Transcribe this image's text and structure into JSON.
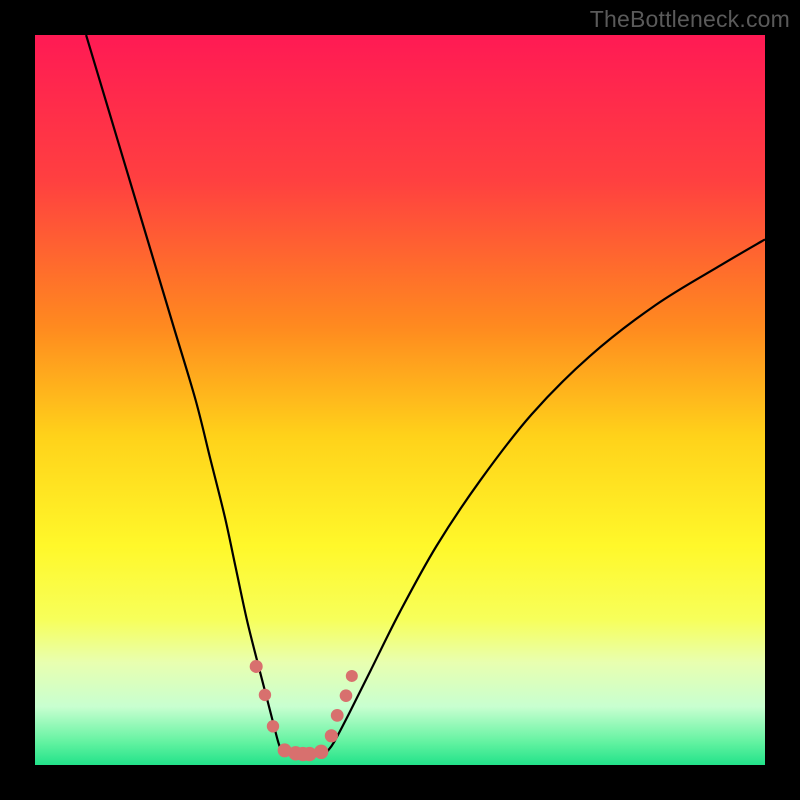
{
  "watermark": "TheBottleneck.com",
  "chart_data": {
    "type": "line",
    "title": "",
    "xlabel": "",
    "ylabel": "",
    "xlim": [
      0,
      100
    ],
    "ylim": [
      0,
      100
    ],
    "gradient_stops": [
      {
        "offset": 0.0,
        "color": "#ff1a54"
      },
      {
        "offset": 0.2,
        "color": "#ff4040"
      },
      {
        "offset": 0.4,
        "color": "#ff8a1f"
      },
      {
        "offset": 0.55,
        "color": "#ffd21a"
      },
      {
        "offset": 0.7,
        "color": "#fff82a"
      },
      {
        "offset": 0.8,
        "color": "#f7ff5a"
      },
      {
        "offset": 0.86,
        "color": "#e8ffb0"
      },
      {
        "offset": 0.92,
        "color": "#c8ffd0"
      },
      {
        "offset": 0.97,
        "color": "#60f2a0"
      },
      {
        "offset": 1.0,
        "color": "#22e28a"
      }
    ],
    "series": [
      {
        "name": "left-branch",
        "x": [
          7,
          10,
          13,
          16,
          19,
          22,
          24,
          26,
          27.5,
          29,
          30.5,
          31.8,
          32.7,
          33.3,
          33.8
        ],
        "y": [
          100,
          90,
          80,
          70,
          60,
          50,
          42,
          34,
          27,
          20,
          14,
          9,
          5.5,
          3.2,
          1.8
        ]
      },
      {
        "name": "right-branch",
        "x": [
          40,
          41,
          43,
          46,
          50,
          55,
          61,
          68,
          76,
          85,
          94,
          100
        ],
        "y": [
          1.8,
          3.2,
          7,
          13,
          21,
          30,
          39,
          48,
          56,
          63,
          68.5,
          72
        ]
      },
      {
        "name": "valley-floor",
        "x": [
          33.8,
          35,
          36.5,
          38,
          40
        ],
        "y": [
          1.8,
          1.4,
          1.3,
          1.4,
          1.8
        ]
      }
    ],
    "markers": {
      "name": "highlight-dots",
      "color": "#d8706e",
      "points": [
        {
          "x": 30.3,
          "y": 13.5,
          "r": 6.5
        },
        {
          "x": 31.5,
          "y": 9.6,
          "r": 6.2
        },
        {
          "x": 32.6,
          "y": 5.3,
          "r": 6.2
        },
        {
          "x": 34.2,
          "y": 2.0,
          "r": 7.0
        },
        {
          "x": 35.7,
          "y": 1.6,
          "r": 7.2
        },
        {
          "x": 36.7,
          "y": 1.5,
          "r": 7.2
        },
        {
          "x": 37.6,
          "y": 1.5,
          "r": 7.2
        },
        {
          "x": 39.2,
          "y": 1.8,
          "r": 7.2
        },
        {
          "x": 40.6,
          "y": 4.0,
          "r": 6.6
        },
        {
          "x": 41.4,
          "y": 6.8,
          "r": 6.4
        },
        {
          "x": 42.6,
          "y": 9.5,
          "r": 6.3
        },
        {
          "x": 43.4,
          "y": 12.2,
          "r": 6.0
        }
      ]
    }
  }
}
